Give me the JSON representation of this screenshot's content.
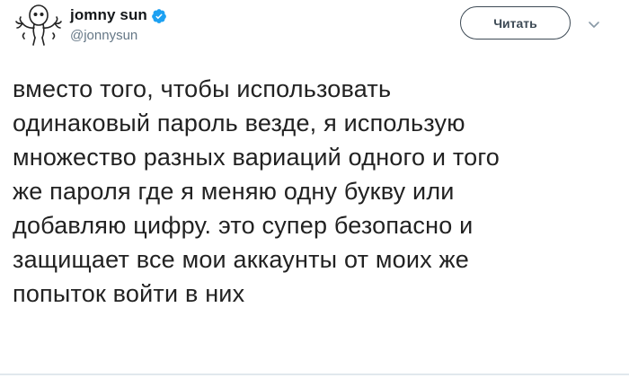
{
  "author": {
    "display_name": "jomny sun",
    "handle": "@jonnysun",
    "verified": true,
    "verified_icon": "verified-badge-icon",
    "avatar_icon": "doodle-avatar-icon"
  },
  "actions": {
    "follow_label": "Читать",
    "menu_icon": "chevron-down-icon"
  },
  "tweet": {
    "lines": [
      "вместо того, чтобы использовать",
      "одинаковый пароль везде, я использую",
      "множество разных вариаций одного и того",
      "же пароля где я меняю одну букву или",
      "добавляю цифру. это супер безопасно и",
      "защищает все мои аккаунты от моих же",
      "попыток войти в них"
    ]
  },
  "colors": {
    "verified_blue": "#1da1f2",
    "handle_gray": "#657786",
    "button_border": "#3d4a55"
  }
}
